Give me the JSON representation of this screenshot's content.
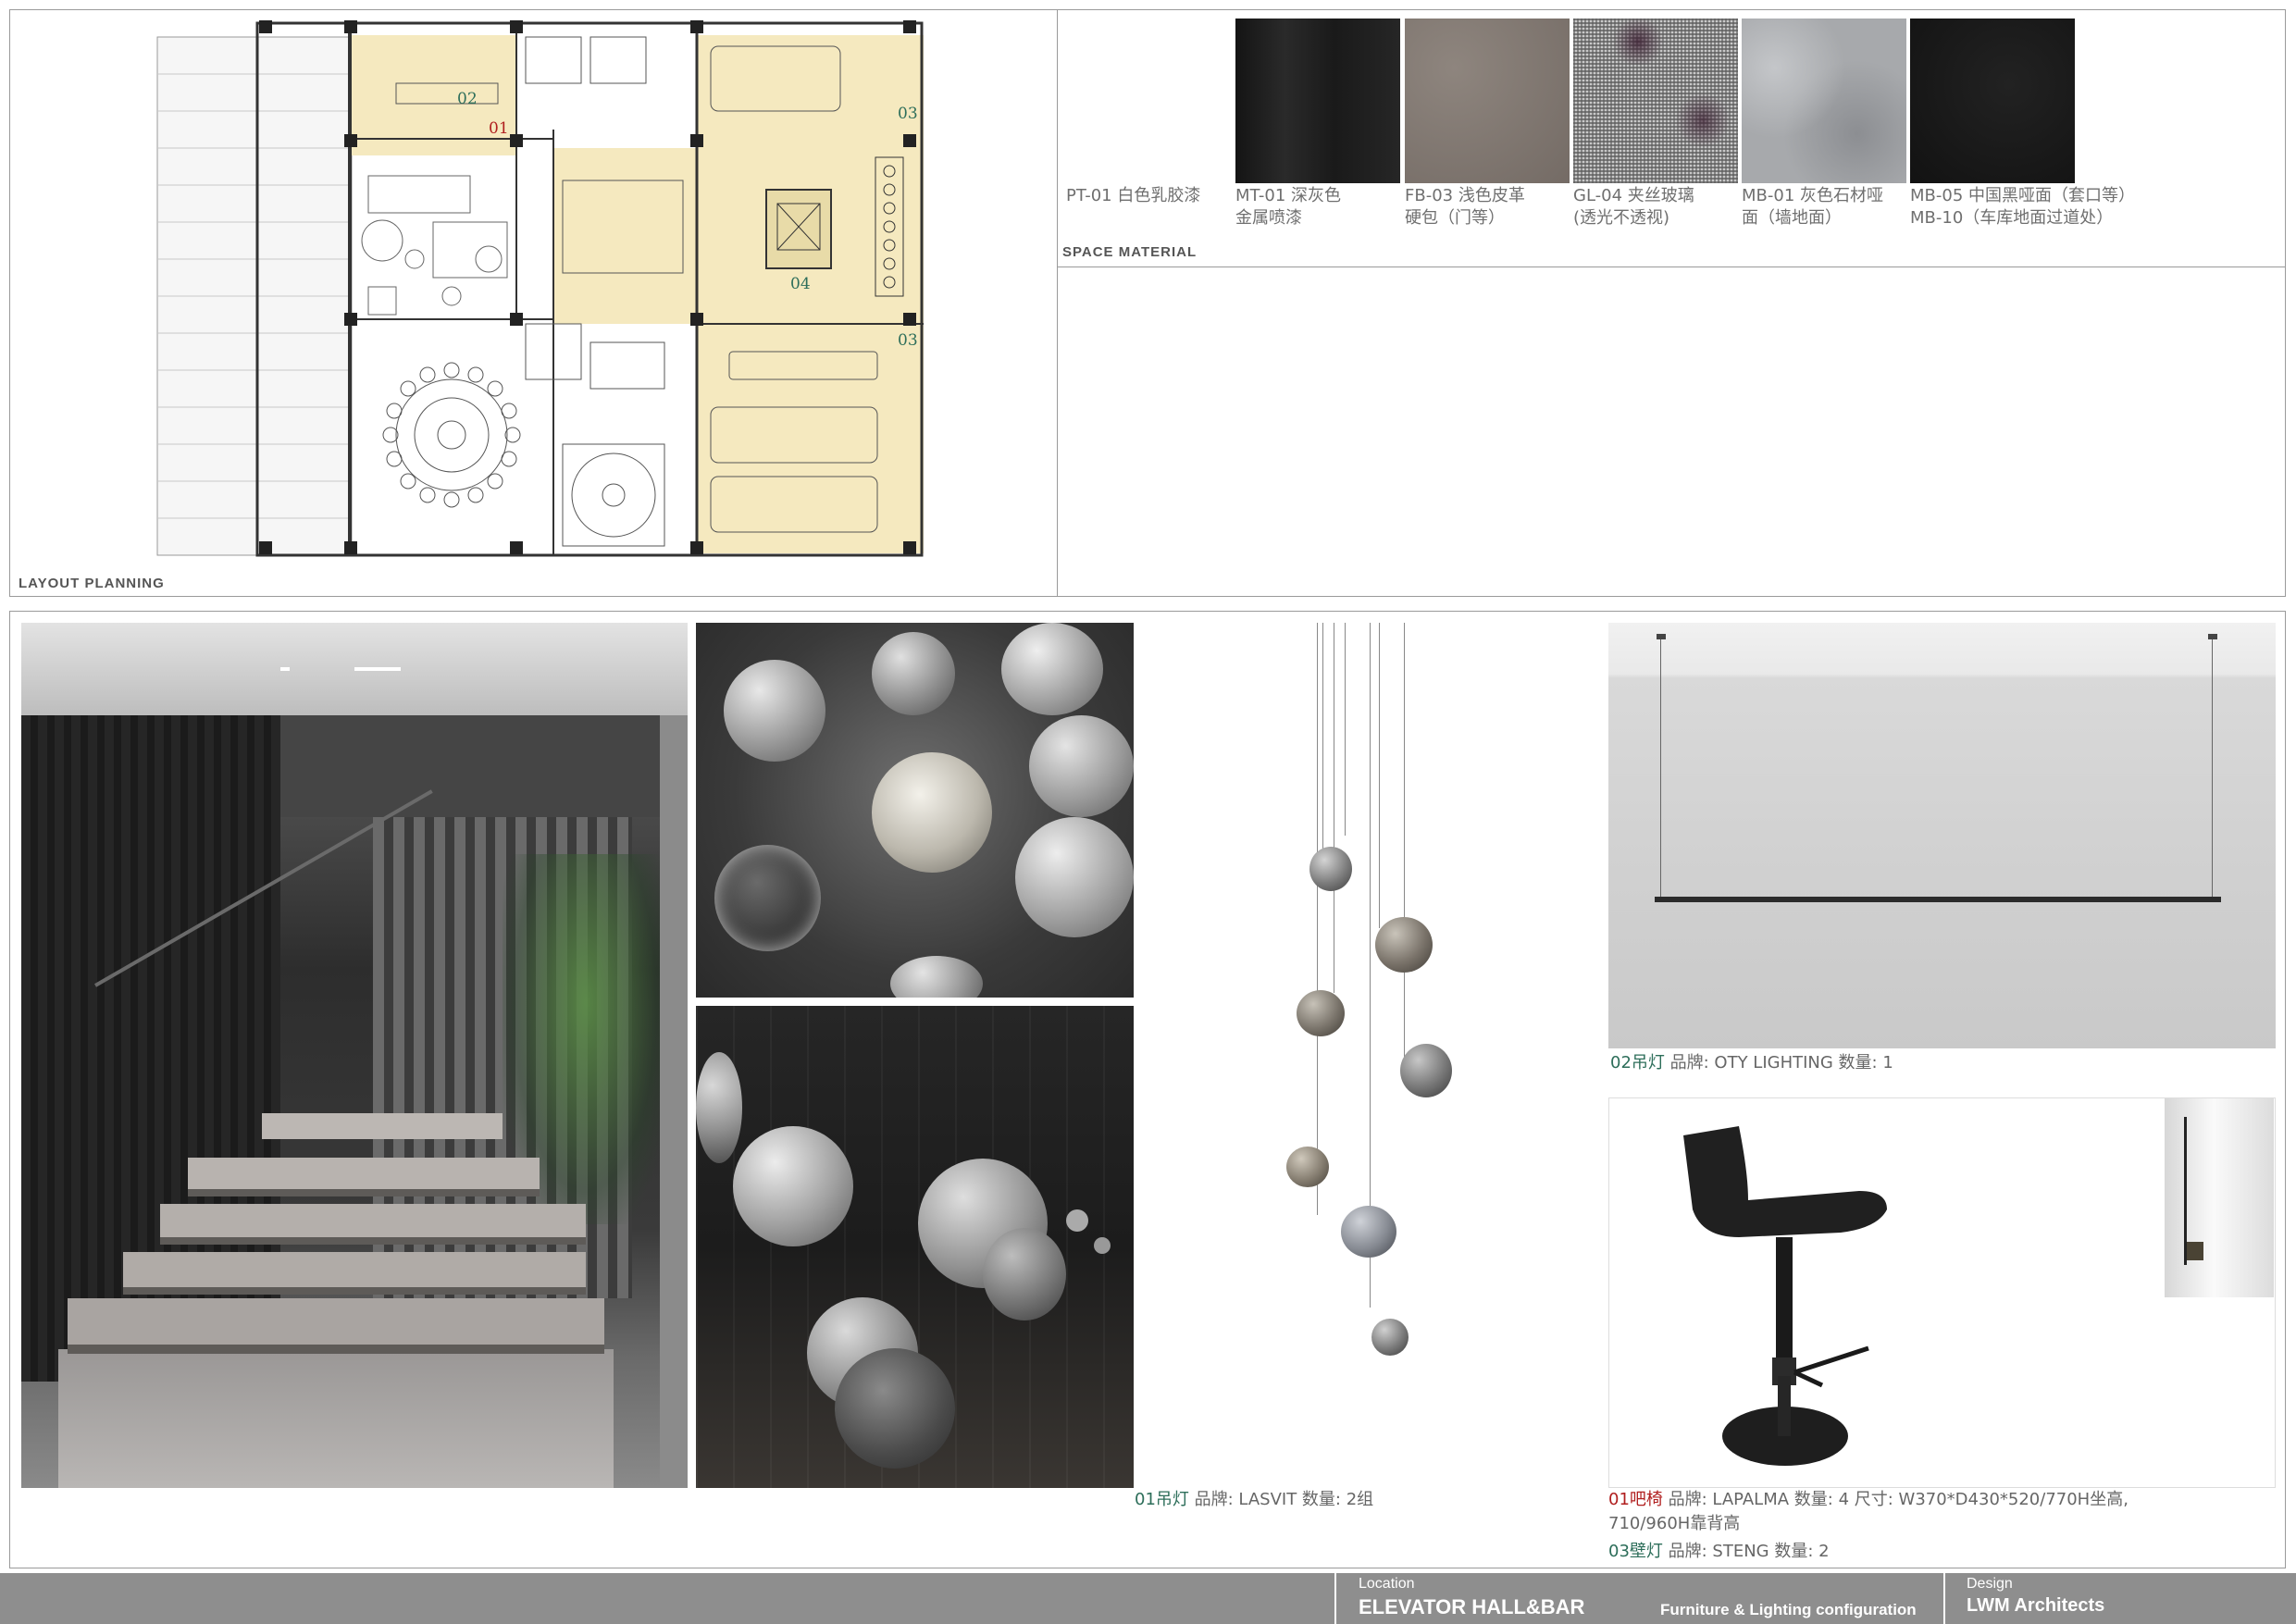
{
  "top_section": {
    "layout_label": "LAYOUT  PLANNING",
    "material_label": "SPACE  MATERIAL",
    "plan_marks": {
      "m01": "01",
      "m02": "02",
      "m03a": "03",
      "m03b": "03",
      "m04": "04"
    }
  },
  "materials": [
    {
      "code": "PT-01",
      "caption": "PT-01 白色乳胶漆",
      "color": "#ffffff"
    },
    {
      "code": "MT-01",
      "caption": "MT-01 深灰色\n金属喷漆",
      "color": "#1c1c1c"
    },
    {
      "code": "FB-03",
      "caption": "FB-03 浅色皮革\n硬包（门等）",
      "color": "#7f766f"
    },
    {
      "code": "GL-04",
      "caption": "GL-04 夹丝玻璃\n(透光不透视)",
      "color": "#8c8c8c"
    },
    {
      "code": "MB-01",
      "caption": "MB-01 灰色石材哑\n面（墙地面）",
      "color": "#a6a8ab"
    },
    {
      "code": "MB-05",
      "caption": "MB-05 中国黑哑面（套口等）\nMB-10（车库地面过道处）",
      "color": "#161616"
    }
  ],
  "products": {
    "pendant01": {
      "index": "01吊灯",
      "text": " 品牌: LASVIT  数量: 2组"
    },
    "pendant02": {
      "index": "02吊灯",
      "text": " 品牌: OTY LIGHTING  数量: 1"
    },
    "barstool01": {
      "index": "01吧椅",
      "text": " 品牌: LAPALMA  数量: 4   尺寸: W370*D430*520/770H坐高,",
      "line2": "710/960H靠背高"
    },
    "walllamp03": {
      "index": "03壁灯",
      "text": " 品牌: STENG  数量: 2"
    }
  },
  "footer": {
    "location_label": "Location",
    "location_value": "ELEVATOR HALL&BAR",
    "subtitle": "Furniture & Lighting configuration",
    "design_label": "Design",
    "design_value": "LWM  Architects"
  }
}
